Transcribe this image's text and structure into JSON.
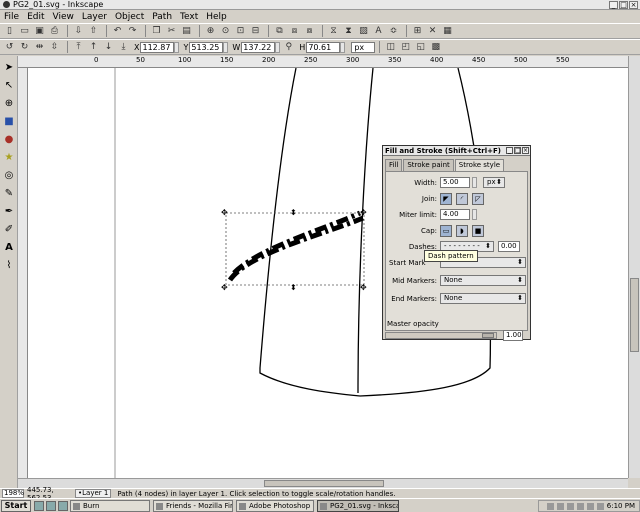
{
  "window": {
    "title": "PG2_01.svg - Inkscape",
    "buttons": [
      "_",
      "□",
      "×"
    ]
  },
  "menu": [
    "File",
    "Edit",
    "View",
    "Layer",
    "Object",
    "Path",
    "Text",
    "Help"
  ],
  "toolbar2": {
    "x_label": "X",
    "x": "112.87",
    "y_label": "Y",
    "y": "513.25",
    "w_label": "W",
    "w": "137.22",
    "h_label": "H",
    "h": "70.61",
    "unit": "px"
  },
  "rulers": {
    "ticks": [
      "0",
      "50",
      "100",
      "150",
      "200",
      "250",
      "300",
      "350",
      "400",
      "450",
      "500",
      "550"
    ]
  },
  "dialog": {
    "title": "Fill and Stroke (Shift+Ctrl+F)",
    "tabs": [
      "Fill",
      "Stroke paint",
      "Stroke style"
    ],
    "width_label": "Width:",
    "width_value": "5.00",
    "width_unit": "px",
    "join_label": "Join:",
    "miter_label": "Miter limit:",
    "miter_value": "4.00",
    "cap_label": "Cap:",
    "dashes_label": "Dashes:",
    "dashes_offset": "0.00",
    "start_label": "Start Mark",
    "mid_label": "Mid Markers:",
    "mid_value": "None",
    "end_label": "End Markers:",
    "end_value": "None",
    "opacity_label": "Master opacity",
    "opacity_value": "1.00"
  },
  "tooltip": "Dash pattern",
  "status": {
    "zoom": "198%",
    "coords": "445.73, 562.53",
    "layer": "•Layer 1",
    "msg": "Path (4 nodes) in layer Layer 1. Click selection to toggle scale/rotation handles."
  },
  "taskbar": {
    "start": "Start",
    "tasks": [
      "Burn",
      "Friends - Mozilla Firefox",
      "Adobe Photoshop",
      "PG2_01.svg - Inkscape"
    ],
    "time": "6:10 PM"
  }
}
